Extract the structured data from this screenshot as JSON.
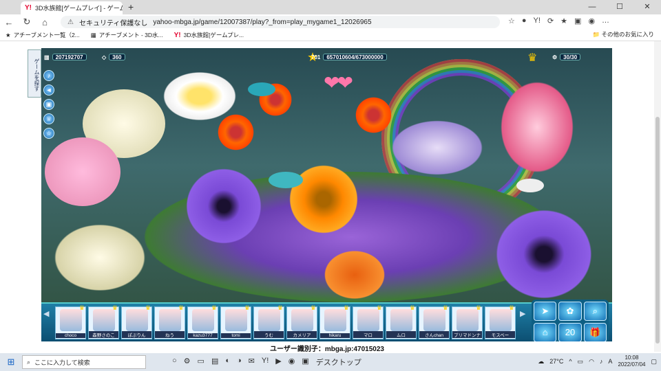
{
  "browser": {
    "tab_title": "3D水族館[ゲームプレイ] - ゲームなら",
    "new_tab": "+",
    "close_tab": "✕",
    "window_controls": [
      "—",
      "☐",
      "✕"
    ],
    "security_label": "セキュリティ保護なし",
    "url": "yahoo-mbga.jp/game/12007387/play?_from=play_mygame1_12026965",
    "bookmarks": [
      "アチーブメント一覧（2...",
      "アチーブメント - 3D水...",
      "3D水族館[ゲームプレ..."
    ],
    "other_favorites": "その他のお気に入り"
  },
  "game": {
    "side_tab": "ゲームを探す",
    "hud": {
      "coins": "207192707",
      "gems": "360",
      "level": "701",
      "exp": "657010604/673000000",
      "fish_count": "30/30"
    },
    "friends": [
      {
        "name": "choco"
      },
      {
        "name": "森野さのこ"
      },
      {
        "name": "ぽぷりん"
      },
      {
        "name": "ねう"
      },
      {
        "name": "kazu3777"
      },
      {
        "name": "tomi"
      },
      {
        "name": "うむ"
      },
      {
        "name": "カメリア"
      },
      {
        "name": "hikaru"
      },
      {
        "name": "マロ"
      },
      {
        "name": "ムロ"
      },
      {
        "name": "さんchan"
      },
      {
        "name": "プリマドンナ"
      },
      {
        "name": "モスベー"
      }
    ],
    "control_counter": "20"
  },
  "user_id_text": "ユーザー識別子：mbga.jp:47015023",
  "taskbar": {
    "search_placeholder": "ここに入力して検索",
    "desktop_label": "デスクトップ",
    "weather": "27°C",
    "ime": "A",
    "time": "10:08",
    "date": "2022/07/04"
  }
}
